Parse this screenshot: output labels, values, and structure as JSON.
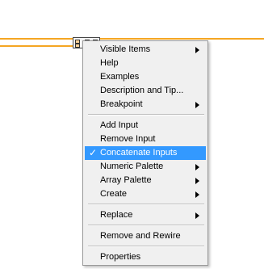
{
  "wire": {
    "color": "#f5a623"
  },
  "node": {
    "icon": "concatenate-strings-node-icon"
  },
  "menu": {
    "items": [
      {
        "label": "Visible Items",
        "submenu": true
      },
      {
        "label": "Help"
      },
      {
        "label": "Examples"
      },
      {
        "label": "Description and Tip..."
      },
      {
        "label": "Breakpoint",
        "submenu": true
      },
      {
        "label": "Add Input"
      },
      {
        "label": "Remove Input"
      },
      {
        "label": "Concatenate Inputs",
        "checked": true,
        "highlighted": true
      },
      {
        "label": "Numeric Palette",
        "submenu": true
      },
      {
        "label": "Array Palette",
        "submenu": true
      },
      {
        "label": "Create",
        "submenu": true
      },
      {
        "label": "Replace",
        "submenu": true
      },
      {
        "label": "Remove and Rewire"
      },
      {
        "label": "Properties"
      }
    ],
    "checkmark": "✓",
    "highlight_color": "#3399ff"
  }
}
